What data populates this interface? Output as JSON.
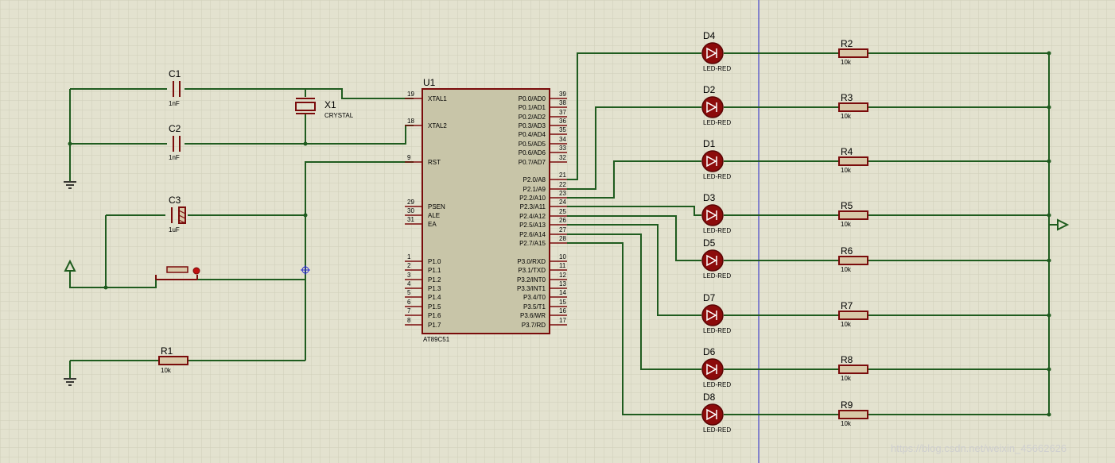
{
  "chip": {
    "ref": "U1",
    "type": "AT89C51",
    "left_pins": [
      {
        "num": "19",
        "name": "XTAL1"
      },
      {
        "num": "18",
        "name": "XTAL2"
      },
      {
        "num": "9",
        "name": "RST"
      },
      {
        "num": "29",
        "name": "PSEN"
      },
      {
        "num": "30",
        "name": "ALE"
      },
      {
        "num": "31",
        "name": "EA"
      },
      {
        "num": "1",
        "name": "P1.0"
      },
      {
        "num": "2",
        "name": "P1.1"
      },
      {
        "num": "3",
        "name": "P1.2"
      },
      {
        "num": "4",
        "name": "P1.3"
      },
      {
        "num": "5",
        "name": "P1.4"
      },
      {
        "num": "6",
        "name": "P1.5"
      },
      {
        "num": "7",
        "name": "P1.6"
      },
      {
        "num": "8",
        "name": "P1.7"
      }
    ],
    "right_pins": [
      {
        "num": "39",
        "name": "P0.0/AD0"
      },
      {
        "num": "38",
        "name": "P0.1/AD1"
      },
      {
        "num": "37",
        "name": "P0.2/AD2"
      },
      {
        "num": "36",
        "name": "P0.3/AD3"
      },
      {
        "num": "35",
        "name": "P0.4/AD4"
      },
      {
        "num": "34",
        "name": "P0.5/AD5"
      },
      {
        "num": "33",
        "name": "P0.6/AD6"
      },
      {
        "num": "32",
        "name": "P0.7/AD7"
      },
      {
        "num": "21",
        "name": "P2.0/A8"
      },
      {
        "num": "22",
        "name": "P2.1/A9"
      },
      {
        "num": "23",
        "name": "P2.2/A10"
      },
      {
        "num": "24",
        "name": "P2.3/A11"
      },
      {
        "num": "25",
        "name": "P2.4/A12"
      },
      {
        "num": "26",
        "name": "P2.5/A13"
      },
      {
        "num": "27",
        "name": "P2.6/A14"
      },
      {
        "num": "28",
        "name": "P2.7/A15"
      },
      {
        "num": "10",
        "name": "P3.0/RXD"
      },
      {
        "num": "11",
        "name": "P3.1/TXD"
      },
      {
        "num": "12",
        "name": "P3.2/INT0"
      },
      {
        "num": "13",
        "name": "P3.3/INT1"
      },
      {
        "num": "14",
        "name": "P3.4/T0"
      },
      {
        "num": "15",
        "name": "P3.5/T1"
      },
      {
        "num": "16",
        "name": "P3.6/WR"
      },
      {
        "num": "17",
        "name": "P3.7/RD"
      }
    ]
  },
  "c1": {
    "ref": "C1",
    "value": "1nF"
  },
  "c2": {
    "ref": "C2",
    "value": "1nF"
  },
  "c3": {
    "ref": "C3",
    "value": "1uF"
  },
  "x1": {
    "ref": "X1",
    "value": "CRYSTAL"
  },
  "r1": {
    "ref": "R1",
    "value": "10k"
  },
  "leds": [
    {
      "ref": "D4",
      "value": "LED-RED"
    },
    {
      "ref": "D2",
      "value": "LED-RED"
    },
    {
      "ref": "D1",
      "value": "LED-RED"
    },
    {
      "ref": "D3",
      "value": "LED-RED"
    },
    {
      "ref": "D5",
      "value": "LED-RED"
    },
    {
      "ref": "D7",
      "value": "LED-RED"
    },
    {
      "ref": "D6",
      "value": "LED-RED"
    },
    {
      "ref": "D8",
      "value": "LED-RED"
    }
  ],
  "resistors": [
    {
      "ref": "R2",
      "value": "10k"
    },
    {
      "ref": "R3",
      "value": "10k"
    },
    {
      "ref": "R4",
      "value": "10k"
    },
    {
      "ref": "R5",
      "value": "10k"
    },
    {
      "ref": "R6",
      "value": "10k"
    },
    {
      "ref": "R7",
      "value": "10k"
    },
    {
      "ref": "R8",
      "value": "10k"
    },
    {
      "ref": "R9",
      "value": "10k"
    }
  ],
  "watermark": "https://blog.csdn.net/weixin_45662626",
  "colors": {
    "background": "#e3e2cf",
    "grid": "#cfcfb9",
    "wire": "#1f5c1f",
    "part": "#7a0b0b",
    "chip_fill": "#c8c5a8",
    "led_fill": "#8c0b0b"
  }
}
